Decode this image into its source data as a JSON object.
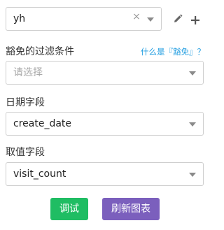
{
  "dimension": {
    "value": "yh",
    "clear_icon": "×"
  },
  "toolbar": {
    "edit_icon": "pencil-icon",
    "add_icon": "plus-icon"
  },
  "filter_field": {
    "label": "豁免的过滤条件",
    "help_link": "什么是『豁免』？",
    "placeholder": "请选择"
  },
  "date_field": {
    "label": "日期字段",
    "value": "create_date"
  },
  "value_field": {
    "label": "取值字段",
    "value": "visit_count"
  },
  "actions": {
    "debug_label": "调试",
    "refresh_label": "刷新图表"
  },
  "colors": {
    "link": "#1e9ce0",
    "debug_button": "#1fbd63",
    "refresh_button": "#7b5fbd"
  }
}
